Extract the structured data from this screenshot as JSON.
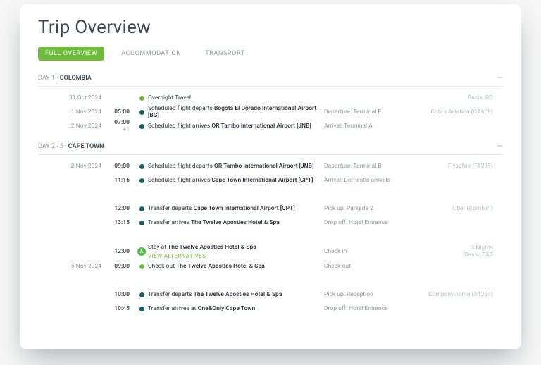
{
  "title": "Trip Overview",
  "tabs": {
    "full": "FULL OVERVIEW",
    "accom": "ACCOMMODATION",
    "trans": "TRANSPORT"
  },
  "sections": [
    {
      "day_label": "DAY 1 ·",
      "place": "COLOMBIA",
      "rows": [
        {
          "date": "31 Oct  2024",
          "time": "",
          "dot": "green",
          "desc_pre": "Overnight Travel",
          "desc_bold": "",
          "meta": "",
          "right": "Basis: RO"
        },
        {
          "date": "1 Nov 2024",
          "time": "05:00",
          "dot": "teal",
          "desc_pre": "Scheduled flight departs ",
          "desc_bold": "Bogota El Dorado International Airport [BG]",
          "meta": "Departure: Terminal F",
          "right": "Cobra Aviation (CA609)"
        },
        {
          "date": "2 Nov 2024",
          "time": "07:00",
          "time_suffix": " +1",
          "dot": "teal",
          "desc_pre": "Scheduled flight arrives ",
          "desc_bold": "OR Tambo International Airport [JNB]",
          "meta": "Arrival: Terminal A",
          "right": ""
        }
      ]
    },
    {
      "day_label": "DAY 2 - 5 ·",
      "place": "CAPE TOWN",
      "rows": [
        {
          "date": "2 Nov 2024",
          "time": "09:00",
          "dot": "teal",
          "desc_pre": "Scheduled flight departs ",
          "desc_bold": "OR Tambo International Airport [JNB]",
          "meta": "Departure: Terminal B",
          "right": "Flysafair (FA239)"
        },
        {
          "date": "",
          "time": "11:15",
          "dot": "teal",
          "desc_pre": "Scheduled flight arrives ",
          "desc_bold": "Cape Town International Airport [CPT]",
          "meta": "Arrival: Domestic arrivals",
          "right": ""
        },
        {
          "spacer": true
        },
        {
          "date": "",
          "time": "12:00",
          "dot": "teal",
          "desc_pre": "Transfer departs ",
          "desc_bold": "Cape Town International Airport [CPT]",
          "meta": "Pick up: Parkade 2",
          "right": "Uber (Comfort)"
        },
        {
          "date": "",
          "time": "13:15",
          "dot": "teal",
          "desc_pre": "Transfer arrives ",
          "desc_bold": "The Twelve Apostles Hotel & Spa",
          "meta": "Drop off: Hotel Entrance",
          "right": ""
        },
        {
          "spacer": true
        },
        {
          "date": "",
          "time": "12:00",
          "dot": "letter",
          "dot_letter": "A",
          "desc_pre": "Stay at ",
          "desc_bold": "The Twelve Apostles Hotel & Spa",
          "meta": "Check in",
          "right": "3 Nights",
          "alt": "VIEW ALTERNATIVES",
          "right2": "Basis: B&B"
        },
        {
          "date": "5 Nov 2024",
          "time": "09:00",
          "dot": "green",
          "desc_pre": "Check out ",
          "desc_bold": "The Twelve Apostles Hotel & Spa",
          "meta": "Check out",
          "right": ""
        },
        {
          "spacer": true
        },
        {
          "date": "",
          "time": "10:00",
          "dot": "teal",
          "desc_pre": "Transfer departs ",
          "desc_bold": "The Twelve Apostles Hotel & Spa",
          "meta": "Pick up: Reception",
          "right": "Company name (A1234)"
        },
        {
          "date": "",
          "time": "10:45",
          "dot": "teal",
          "desc_pre": "Transfer arrives at ",
          "desc_bold": "One&Only Cape Town",
          "meta": "Drop off: Hotel Entrance",
          "right": ""
        }
      ]
    }
  ],
  "collapse_glyph": "–"
}
